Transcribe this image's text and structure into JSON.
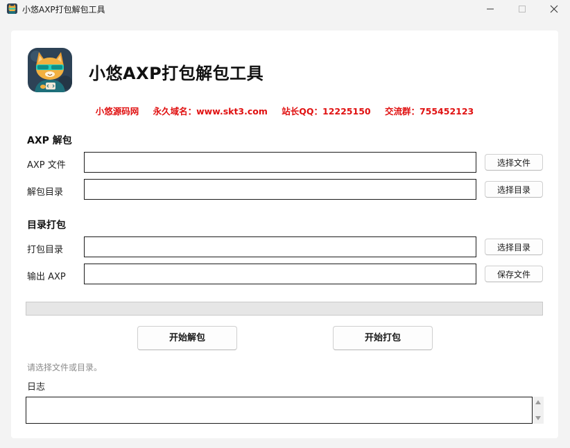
{
  "window": {
    "title": "小悠AXP打包解包工具"
  },
  "header": {
    "app_title": "小悠AXP打包解包工具",
    "info": [
      "小悠源码网",
      "永久域名：www.skt3.com",
      "站长QQ：12225150",
      "交流群：755452123"
    ],
    "info_color": "#e01010"
  },
  "unpack": {
    "section_title": "AXP 解包",
    "axp_file": {
      "label": "AXP 文件",
      "value": "",
      "button": "选择文件"
    },
    "out_dir": {
      "label": "解包目录",
      "value": "",
      "button": "选择目录"
    }
  },
  "pack": {
    "section_title": "目录打包",
    "src_dir": {
      "label": "打包目录",
      "value": "",
      "button": "选择目录"
    },
    "out_axp": {
      "label": "输出 AXP",
      "value": "",
      "button": "保存文件"
    }
  },
  "progress": {
    "value": 0
  },
  "actions": {
    "start_unpack": "开始解包",
    "start_pack": "开始打包"
  },
  "status": "请选择文件或目录。",
  "log": {
    "label": "日志",
    "content": ""
  },
  "icons": {
    "app": "cat-mascot-icon",
    "minimize": "minimize-icon",
    "maximize": "maximize-icon",
    "close": "close-icon"
  }
}
